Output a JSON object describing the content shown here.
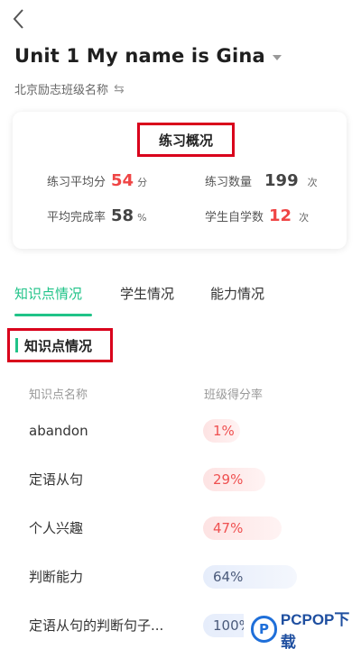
{
  "header": {
    "back_icon": "chevron-left-icon",
    "title": "Unit 1 My name is Gina",
    "class_name": "北京励志班级名称",
    "swap_icon": "⇆"
  },
  "summary": {
    "title": "练习概况",
    "stats": {
      "avg_score": {
        "label": "练习平均分",
        "value": "54",
        "unit": "分"
      },
      "practice_count": {
        "label": "练习数量",
        "value": "199",
        "unit": "次"
      },
      "completion_rate": {
        "label": "平均完成率",
        "value": "58",
        "unit": "%"
      },
      "self_study": {
        "label": "学生自学数",
        "value": "12",
        "unit": "次"
      }
    }
  },
  "tabs": [
    {
      "label": "知识点情况",
      "active": true
    },
    {
      "label": "学生情况",
      "active": false
    },
    {
      "label": "能力情况",
      "active": false
    }
  ],
  "section": {
    "title": "知识点情况",
    "col_name": "知识点名称",
    "col_rate": "班级得分率"
  },
  "knowledge_rows": [
    {
      "name": "abandon",
      "rate": "1%",
      "level": 0.01,
      "tone": "red"
    },
    {
      "name": "定语从句",
      "rate": "29%",
      "level": 0.29,
      "tone": "red"
    },
    {
      "name": "个人兴趣",
      "rate": "47%",
      "level": 0.47,
      "tone": "red"
    },
    {
      "name": "判断能力",
      "rate": "64%",
      "level": 0.64,
      "tone": "blue"
    },
    {
      "name": "定语从句的判断句子...",
      "rate": "100%",
      "level": 1.0,
      "tone": "blue"
    }
  ],
  "watermark": {
    "logo_letter": "P",
    "text": "PCPOP下载"
  },
  "colors": {
    "accent": "#20c388",
    "highlight": "#ef4545",
    "annotation": "#d9001b"
  }
}
